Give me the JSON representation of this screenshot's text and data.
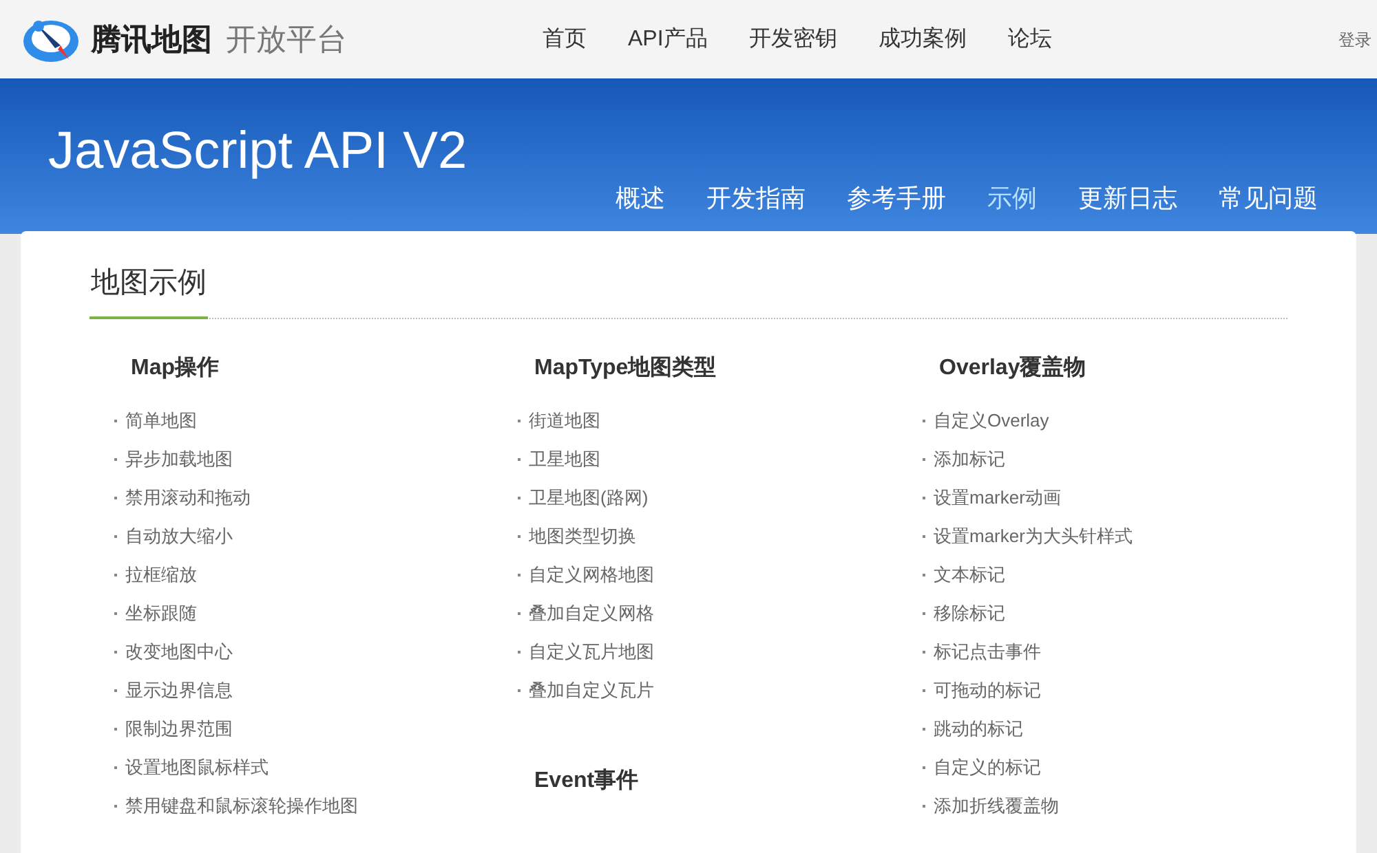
{
  "header": {
    "brand": "腾讯地图",
    "subbrand": "开放平台",
    "nav": [
      "首页",
      "API产品",
      "开发密钥",
      "成功案例",
      "论坛"
    ],
    "login": "登录"
  },
  "banner": {
    "title": "JavaScript API V2",
    "tabs": [
      {
        "label": "概述",
        "selected": false
      },
      {
        "label": "开发指南",
        "selected": false
      },
      {
        "label": "参考手册",
        "selected": false
      },
      {
        "label": "示例",
        "selected": true
      },
      {
        "label": "更新日志",
        "selected": false
      },
      {
        "label": "常见问题",
        "selected": false
      }
    ]
  },
  "content": {
    "heading": "地图示例",
    "columns": [
      {
        "sections": [
          {
            "title": "Map操作",
            "items": [
              "简单地图",
              "异步加载地图",
              "禁用滚动和拖动",
              "自动放大缩小",
              "拉框缩放",
              "坐标跟随",
              "改变地图中心",
              "显示边界信息",
              "限制边界范围",
              "设置地图鼠标样式",
              "禁用键盘和鼠标滚轮操作地图"
            ]
          }
        ]
      },
      {
        "sections": [
          {
            "title": "MapType地图类型",
            "items": [
              "街道地图",
              "卫星地图",
              "卫星地图(路网)",
              "地图类型切换",
              "自定义网格地图",
              "叠加自定义网格",
              "自定义瓦片地图",
              "叠加自定义瓦片"
            ]
          },
          {
            "title": "Event事件"
          }
        ]
      },
      {
        "sections": [
          {
            "title": "Overlay覆盖物",
            "items": [
              "自定义Overlay",
              "添加标记",
              "设置marker动画",
              "设置marker为大头针样式",
              "文本标记",
              "移除标记",
              "标记点击事件",
              "可拖动的标记",
              "跳动的标记",
              "自定义的标记",
              "添加折线覆盖物"
            ]
          }
        ]
      }
    ]
  }
}
